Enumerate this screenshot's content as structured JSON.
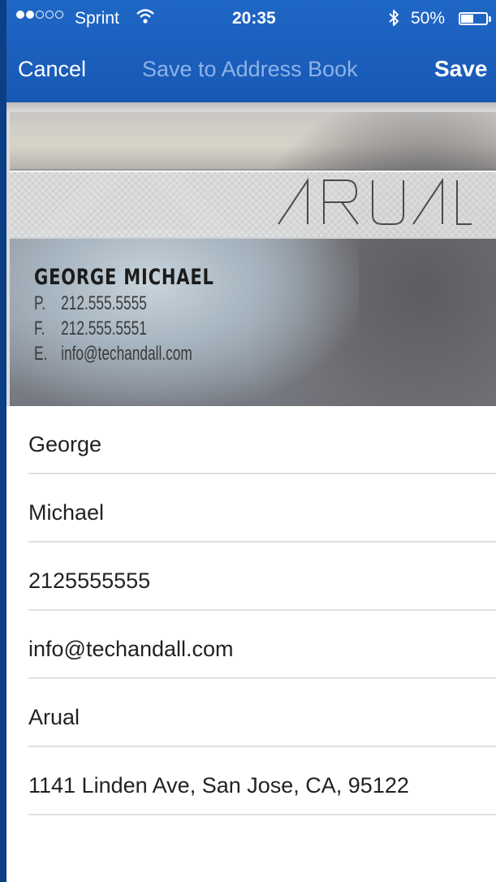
{
  "status_bar": {
    "carrier": "Sprint",
    "time": "20:35",
    "battery": "50%",
    "battery_level": 0.5,
    "signal_bars_filled": 2,
    "signal_bars_total": 5
  },
  "nav": {
    "cancel": "Cancel",
    "title": "Save to Address Book",
    "save": "Save"
  },
  "card": {
    "logo": "ARUAL",
    "name": "GEORGE MICHAEL",
    "phone_label": "P.",
    "phone": "212.555.5555",
    "fax_label": "F.",
    "fax": "212.555.5551",
    "email_label": "E.",
    "email": "info@techandall.com"
  },
  "fields": [
    "George",
    "Michael",
    "2125555555",
    "info@techandall.com",
    "Arual",
    "1141 Linden Ave, San Jose, CA, 95122"
  ],
  "colors": {
    "nav_background": "#1b5fbd",
    "nav_title": "#8fb3e6",
    "separator": "#e1e1e1"
  }
}
